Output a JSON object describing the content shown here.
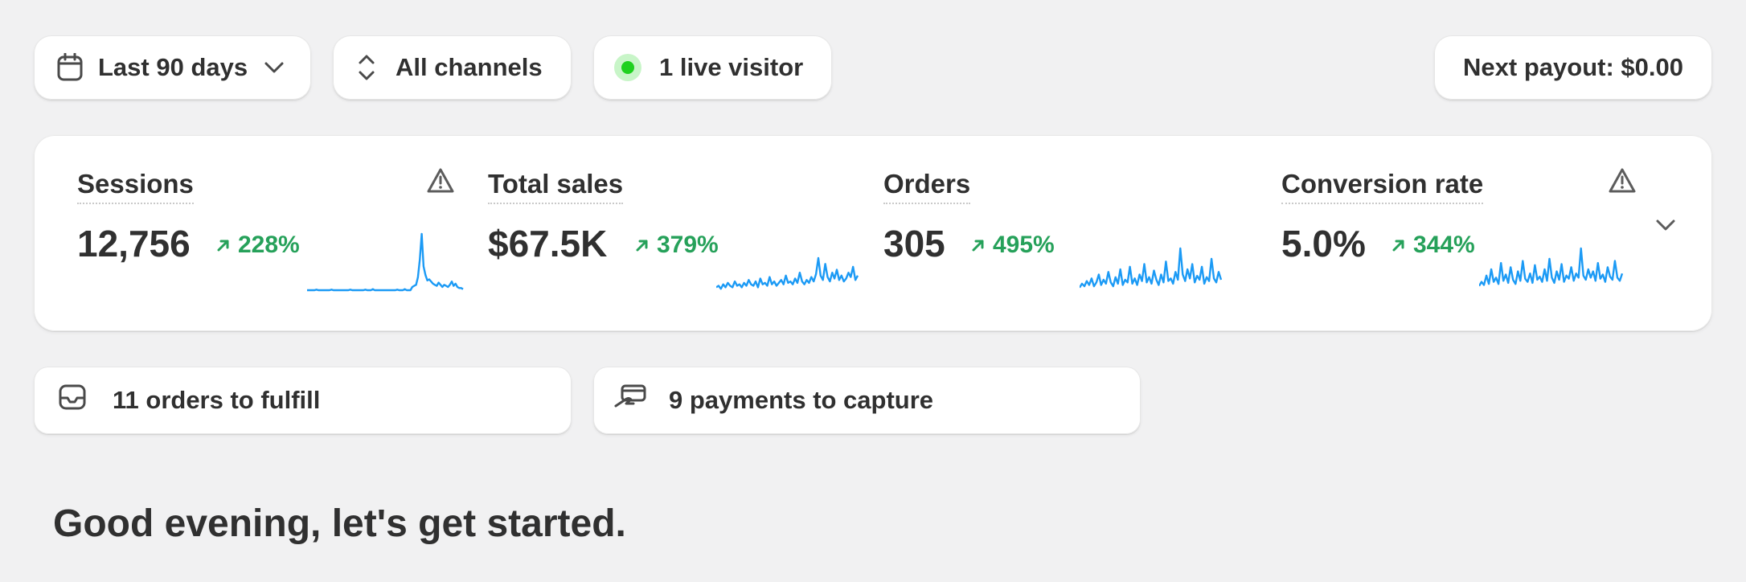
{
  "filters": {
    "date_range": "Last 90 days",
    "channel": "All channels",
    "live_visitors": "1 live visitor",
    "payout": "Next payout: $0.00"
  },
  "metrics": [
    {
      "label": "Sessions",
      "value": "12,756",
      "change": "228%",
      "warning": true,
      "sparkline": [
        0,
        0,
        0,
        0,
        0,
        0.5,
        0,
        0,
        0,
        0,
        0,
        0,
        0,
        0.5,
        0,
        0,
        0,
        0,
        0,
        0,
        0,
        0,
        0,
        0.5,
        0,
        0,
        0,
        0,
        0,
        0,
        0,
        0.5,
        0,
        0,
        0,
        1,
        0,
        0,
        0,
        0,
        0,
        0,
        0,
        0,
        0,
        0,
        0,
        0,
        0.5,
        0,
        0,
        0,
        1,
        0,
        0,
        0,
        3,
        4,
        5,
        12,
        28,
        52,
        22,
        14,
        9,
        10,
        8,
        6,
        5,
        4,
        7,
        5,
        3,
        5,
        4,
        3,
        5,
        8,
        4,
        6,
        3,
        2,
        2,
        1
      ]
    },
    {
      "label": "Total sales",
      "value": "$67.5K",
      "change": "379%",
      "warning": false,
      "sparkline": [
        2,
        3,
        1,
        4,
        2,
        5,
        3,
        2,
        6,
        3,
        4,
        2,
        5,
        3,
        7,
        4,
        3,
        6,
        2,
        8,
        4,
        5,
        3,
        9,
        4,
        6,
        3,
        5,
        7,
        4,
        10,
        5,
        6,
        4,
        8,
        5,
        12,
        6,
        4,
        7,
        5,
        9,
        6,
        11,
        22,
        10,
        7,
        18,
        9,
        6,
        12,
        8,
        14,
        7,
        10,
        6,
        8,
        12,
        9,
        16,
        7,
        10
      ]
    },
    {
      "label": "Orders",
      "value": "305",
      "change": "495%",
      "warning": false,
      "sparkline": [
        2,
        5,
        3,
        7,
        4,
        9,
        3,
        6,
        12,
        4,
        8,
        5,
        14,
        6,
        3,
        10,
        5,
        16,
        4,
        8,
        6,
        18,
        5,
        9,
        4,
        12,
        7,
        20,
        6,
        10,
        5,
        15,
        8,
        4,
        12,
        6,
        22,
        7,
        9,
        5,
        14,
        8,
        32,
        12,
        7,
        16,
        9,
        20,
        6,
        11,
        8,
        18,
        5,
        10,
        7,
        24,
        9,
        6,
        14,
        8
      ]
    },
    {
      "label": "Conversion rate",
      "value": "5.0%",
      "change": "344%",
      "warning": true,
      "sparkline": [
        4,
        8,
        5,
        14,
        6,
        20,
        8,
        12,
        6,
        26,
        9,
        15,
        7,
        22,
        10,
        6,
        18,
        9,
        28,
        11,
        8,
        16,
        7,
        24,
        10,
        13,
        8,
        20,
        9,
        30,
        12,
        7,
        18,
        10,
        25,
        8,
        14,
        11,
        22,
        9,
        16,
        12,
        40,
        14,
        10,
        20,
        12,
        18,
        9,
        26,
        11,
        15,
        8,
        22,
        13,
        10,
        28,
        12,
        9,
        16
      ]
    }
  ],
  "tasks": [
    {
      "label": "11 orders to fulfill"
    },
    {
      "label": "9 payments to capture"
    }
  ],
  "greeting": "Good evening, let's get started.",
  "colors": {
    "sparkline": "#1b9af5",
    "positive": "#26a15a",
    "live": "#1fd11f"
  }
}
